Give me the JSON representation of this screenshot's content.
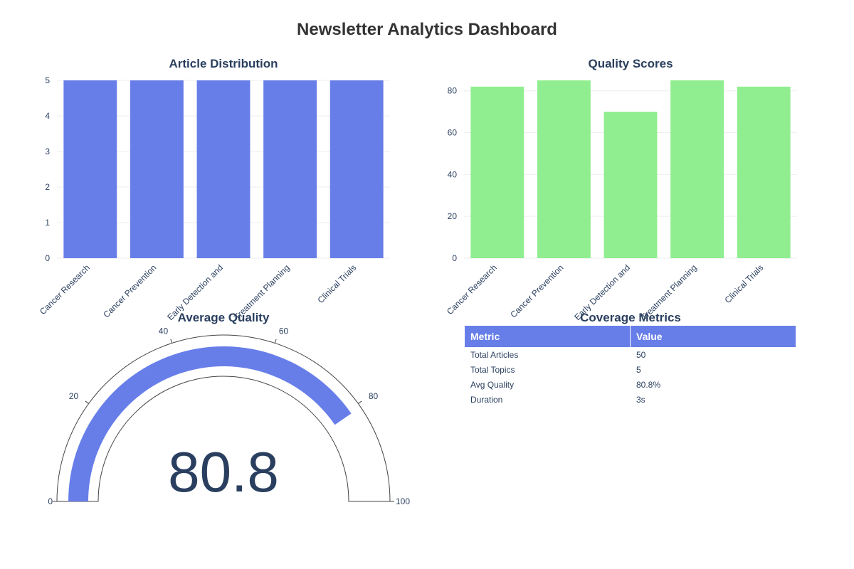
{
  "title": "Newsletter Analytics Dashboard",
  "colors": {
    "bar_blue": "#677ee9",
    "bar_green": "#90ee90",
    "gauge": "#677ee9",
    "text": "#2a3f5f"
  },
  "chart_data": [
    {
      "type": "bar",
      "title": "Article Distribution",
      "categories": [
        "Cancer Research",
        "Cancer Prevention",
        "Early Detection and",
        "Treatment Planning",
        "Clinical Trials"
      ],
      "values": [
        5,
        5,
        5,
        5,
        5
      ],
      "ylim": [
        0,
        5
      ],
      "yticks": [
        0,
        1,
        2,
        3,
        4,
        5
      ],
      "color": "#677ee9",
      "grid": true
    },
    {
      "type": "bar",
      "title": "Quality Scores",
      "categories": [
        "Cancer Research",
        "Cancer Prevention",
        "Early Detection and",
        "Treatment Planning",
        "Clinical Trials"
      ],
      "values": [
        82,
        85,
        70,
        85,
        82
      ],
      "ylim": [
        0,
        85
      ],
      "yticks": [
        0,
        20,
        40,
        60,
        80
      ],
      "color": "#90ee90",
      "grid": true
    },
    {
      "type": "gauge",
      "title": "Average Quality",
      "value": 80.8,
      "value_label": "80.8",
      "range": [
        0,
        100
      ],
      "ticks": [
        0,
        20,
        40,
        60,
        80,
        100
      ],
      "color": "#677ee9"
    },
    {
      "type": "table",
      "title": "Coverage Metrics",
      "columns": [
        "Metric",
        "Value"
      ],
      "rows": [
        [
          "Total Articles",
          "50"
        ],
        [
          "Total Topics",
          "5"
        ],
        [
          "Avg Quality",
          "80.8%"
        ],
        [
          "Duration",
          "3s"
        ]
      ]
    }
  ]
}
